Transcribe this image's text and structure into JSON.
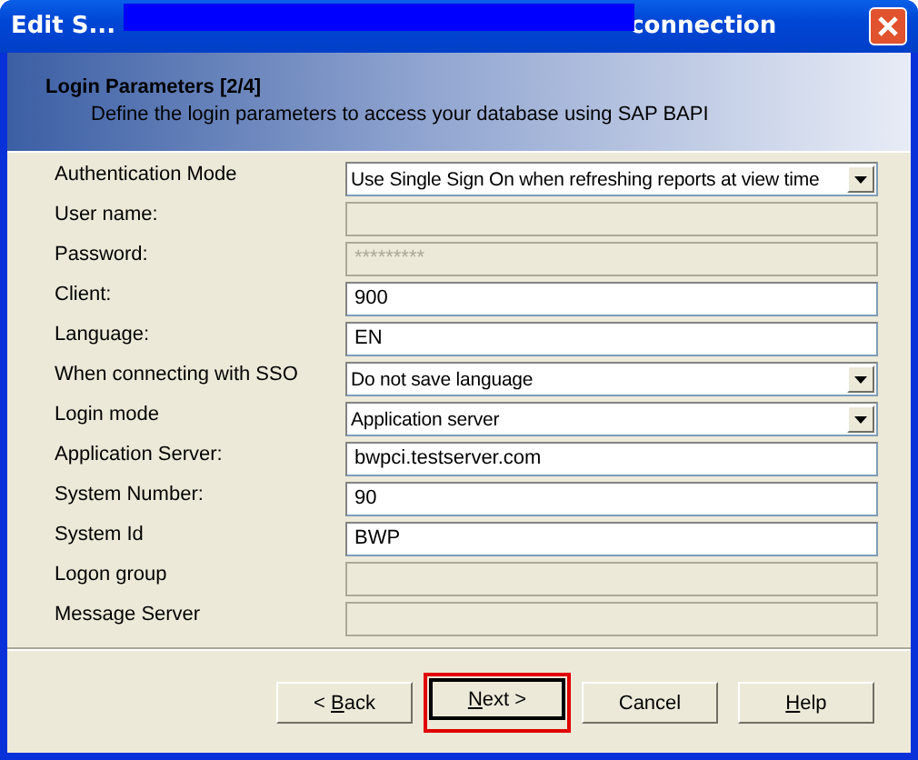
{
  "window": {
    "title_start": "Edit S...",
    "title_end": "connection",
    "redacted": true
  },
  "header": {
    "title": "Login Parameters [2/4]",
    "subtitle": "Define the login parameters to access your database using SAP BAPI"
  },
  "fields": [
    {
      "label": "Authentication Mode",
      "kind": "dropdown",
      "value": "Use Single Sign On when refreshing reports at view time",
      "disabled": false
    },
    {
      "label": "User name:",
      "kind": "text",
      "disabled": true
    },
    {
      "label": "Password:",
      "kind": "text",
      "value": "*********",
      "disabled": true
    },
    {
      "label": "Client:",
      "kind": "text",
      "value": "900",
      "disabled": false
    },
    {
      "label": "Language:",
      "kind": "text",
      "value": "EN",
      "disabled": false
    },
    {
      "label": "When connecting with SSO",
      "kind": "dropdown",
      "value": "Do not save language",
      "disabled": false
    },
    {
      "label": "Login mode",
      "kind": "dropdown",
      "value": "Application server",
      "disabled": false
    },
    {
      "label": "Application Server:",
      "kind": "text",
      "value": "bwpci.testserver.com",
      "disabled": false
    },
    {
      "label": "System Number:",
      "kind": "text",
      "value": "90",
      "disabled": false
    },
    {
      "label": "System Id",
      "kind": "text",
      "value": "BWP",
      "disabled": false
    },
    {
      "label": "Logon group",
      "kind": "text",
      "disabled": true
    },
    {
      "label": "Message Server",
      "kind": "text",
      "disabled": true
    }
  ],
  "buttons": [
    {
      "pre": "< ",
      "key": "B",
      "post": "ack",
      "default": false,
      "highlighted": false
    },
    {
      "key": "N",
      "post": "ext >",
      "default": true,
      "highlighted": true
    },
    {
      "pre": "Cancel",
      "default": false,
      "highlighted": false
    },
    {
      "key": "H",
      "post": "elp",
      "default": false,
      "highlighted": false
    }
  ]
}
